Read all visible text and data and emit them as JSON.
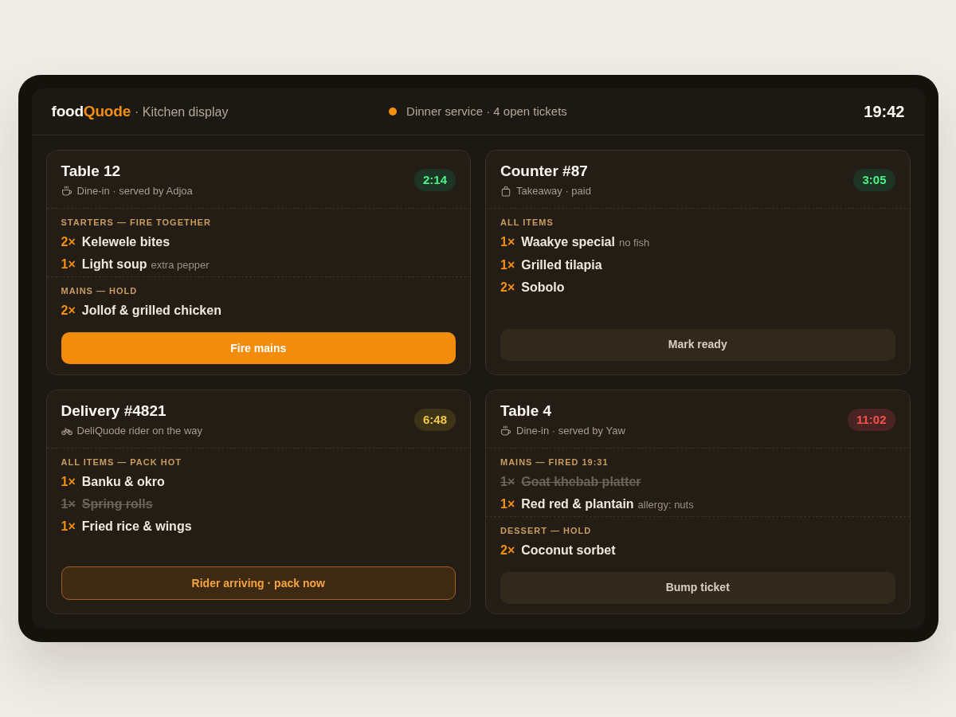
{
  "header": {
    "brand": {
      "base": "food",
      "accent": "Quode"
    },
    "subtitle": "· Kitchen display",
    "status": "Dinner service · 4 open tickets",
    "clock": "19:42"
  },
  "tickets": [
    {
      "title": "Table 12",
      "kind": "dine_in",
      "subtitle": "Dine-in · served by Adjoa",
      "timer": {
        "text": "2:14",
        "color": "#1e3526"
      },
      "sections": [
        {
          "label": "STARTERS — FIRE TOGETHER",
          "items": [
            {
              "qty": "2×",
              "name": "Kelewele bites",
              "done": false
            },
            {
              "qty": "1×",
              "name": "Light soup",
              "note": "extra pepper",
              "done": false
            }
          ]
        },
        {
          "label": "MAINS — HOLD",
          "items": [
            {
              "qty": "2×",
              "name": "Jollof & grilled chicken",
              "done": false
            }
          ]
        }
      ],
      "action": {
        "label": "Fire mains",
        "kind": "primary"
      }
    },
    {
      "title": "Counter #87",
      "kind": "takeaway",
      "subtitle": "Takeaway · paid",
      "timer": {
        "text": "3:05",
        "color": "#1e3526"
      },
      "sections": [
        {
          "label": "ALL ITEMS",
          "items": [
            {
              "qty": "1×",
              "name": "Waakye special",
              "note": "no fish",
              "done": false
            },
            {
              "qty": "1×",
              "name": "Grilled tilapia",
              "done": false
            },
            {
              "qty": "2×",
              "name": "Sobolo",
              "done": false
            }
          ]
        }
      ],
      "action": {
        "label": "Mark ready",
        "kind": "neutral"
      }
    },
    {
      "title": "Delivery #4821",
      "kind": "delivery",
      "subtitle": "DeliQuode rider on the way",
      "timer": {
        "text": "6:48",
        "color": "#3d3316"
      },
      "sections": [
        {
          "label": "ALL ITEMS — PACK HOT",
          "items": [
            {
              "qty": "1×",
              "name": "Banku & okro",
              "done": false
            },
            {
              "qty": "1×",
              "name": "Spring rolls",
              "done": true
            },
            {
              "qty": "1×",
              "name": "Fried rice & wings",
              "done": false
            }
          ]
        }
      ],
      "action": {
        "label": "Rider arriving · pack now",
        "kind": "alert"
      }
    },
    {
      "title": "Table 4",
      "kind": "dine_in",
      "subtitle": "Dine-in · served by Yaw",
      "timer": {
        "text": "11:02",
        "color": "#4a2422"
      },
      "sections": [
        {
          "label": "MAINS — FIRED 19:31",
          "items": [
            {
              "qty": "1×",
              "name": "Goat khebab platter",
              "done": true
            },
            {
              "qty": "1×",
              "name": "Red red & plantain",
              "note": "allergy: nuts",
              "done": false
            }
          ]
        },
        {
          "label": "DESSERT — HOLD",
          "items": [
            {
              "qty": "2×",
              "name": "Coconut sorbet",
              "done": false
            }
          ]
        }
      ],
      "action": {
        "label": "Bump ticket",
        "kind": "neutral"
      }
    }
  ]
}
